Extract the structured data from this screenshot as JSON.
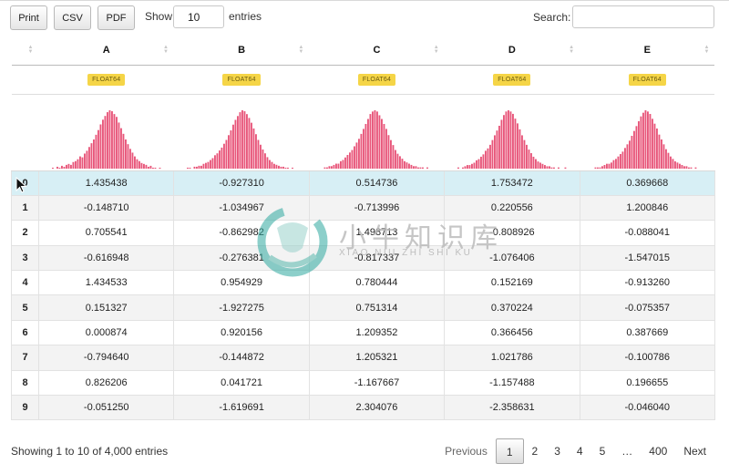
{
  "toolbar": {
    "print_label": "Print",
    "csv_label": "CSV",
    "pdf_label": "PDF",
    "show_label": "Show",
    "page_length": "10",
    "entries_label": "entries",
    "search_label": "Search:",
    "search_value": ""
  },
  "columns": [
    {
      "name": "A",
      "dtype": "FLOAT64"
    },
    {
      "name": "B",
      "dtype": "FLOAT64"
    },
    {
      "name": "C",
      "dtype": "FLOAT64"
    },
    {
      "name": "D",
      "dtype": "FLOAT64"
    },
    {
      "name": "E",
      "dtype": "FLOAT64"
    }
  ],
  "rows": [
    {
      "index": "0",
      "values": [
        "1.435438",
        "-0.927310",
        "0.514736",
        "1.753472",
        "0.369668"
      ]
    },
    {
      "index": "1",
      "values": [
        "-0.148710",
        "-1.034967",
        "-0.713996",
        "0.220556",
        "1.200846"
      ]
    },
    {
      "index": "2",
      "values": [
        "0.705541",
        "-0.862982",
        "1.498713",
        "-0.808926",
        "-0.088041"
      ]
    },
    {
      "index": "3",
      "values": [
        "-0.616948",
        "-0.276381",
        "-0.817337",
        "-1.076406",
        "-1.547015"
      ]
    },
    {
      "index": "4",
      "values": [
        "1.434533",
        "0.954929",
        "0.780444",
        "0.152169",
        "-0.913260"
      ]
    },
    {
      "index": "5",
      "values": [
        "0.151327",
        "-1.927275",
        "0.751314",
        "0.370224",
        "-0.075357"
      ]
    },
    {
      "index": "6",
      "values": [
        "0.000874",
        "0.920156",
        "1.209352",
        "0.366456",
        "0.387669"
      ]
    },
    {
      "index": "7",
      "values": [
        "-0.794640",
        "-0.144872",
        "1.205321",
        "1.021786",
        "-0.100786"
      ]
    },
    {
      "index": "8",
      "values": [
        "0.826206",
        "0.041721",
        "-1.167667",
        "-1.157488",
        "0.196655"
      ]
    },
    {
      "index": "9",
      "values": [
        "-0.051250",
        "-1.619691",
        "2.304076",
        "-2.358631",
        "-0.046040"
      ]
    }
  ],
  "selected_row": 0,
  "histograms": [
    [
      1,
      0,
      2,
      1,
      3,
      2,
      4,
      5,
      4,
      7,
      8,
      10,
      13,
      12,
      16,
      19,
      23,
      27,
      31,
      36,
      41,
      47,
      52,
      56,
      60,
      62,
      61,
      58,
      55,
      49,
      43,
      37,
      31,
      26,
      21,
      17,
      13,
      10,
      8,
      6,
      5,
      4,
      2,
      3,
      1,
      1,
      0,
      1
    ],
    [
      1,
      1,
      0,
      2,
      2,
      3,
      3,
      5,
      6,
      7,
      9,
      11,
      14,
      16,
      19,
      22,
      26,
      30,
      35,
      40,
      46,
      51,
      55,
      59,
      61,
      60,
      57,
      53,
      48,
      42,
      36,
      30,
      25,
      20,
      16,
      12,
      9,
      7,
      5,
      4,
      3,
      2,
      2,
      1,
      1,
      0,
      1,
      0
    ],
    [
      0,
      1,
      1,
      2,
      2,
      3,
      4,
      4,
      6,
      7,
      9,
      11,
      13,
      15,
      18,
      21,
      24,
      28,
      32,
      36,
      40,
      44,
      46,
      47,
      46,
      43,
      40,
      36,
      32,
      27,
      23,
      19,
      15,
      12,
      10,
      8,
      6,
      5,
      4,
      3,
      2,
      2,
      1,
      1,
      1,
      0,
      1,
      0
    ],
    [
      1,
      0,
      1,
      2,
      3,
      3,
      4,
      5,
      7,
      8,
      10,
      12,
      15,
      17,
      20,
      24,
      28,
      32,
      36,
      41,
      45,
      48,
      49,
      48,
      46,
      42,
      38,
      33,
      28,
      24,
      20,
      16,
      13,
      10,
      8,
      6,
      5,
      4,
      3,
      2,
      2,
      1,
      1,
      0,
      1,
      0,
      0,
      1
    ],
    [
      0,
      1,
      1,
      1,
      2,
      3,
      4,
      4,
      5,
      7,
      8,
      10,
      12,
      14,
      17,
      20,
      23,
      27,
      31,
      35,
      39,
      43,
      46,
      48,
      47,
      45,
      41,
      37,
      33,
      28,
      24,
      20,
      16,
      13,
      10,
      8,
      6,
      5,
      4,
      3,
      2,
      2,
      1,
      1,
      0,
      1,
      0,
      0
    ]
  ],
  "footer": {
    "info": "Showing 1 to 10 of 4,000 entries",
    "previous": "Previous",
    "next": "Next",
    "pages": [
      "1",
      "2",
      "3",
      "4",
      "5",
      "…",
      "400"
    ],
    "current_page": "1"
  },
  "watermark": {
    "title": "小牛知识库",
    "subtitle": "XIAO NIU ZHI SHI KU"
  },
  "colors": {
    "histogram_bar": "#e8567a",
    "badge": "#f5d547",
    "selected_row": "#d7eff5",
    "stripe": "#f3f3f3"
  }
}
